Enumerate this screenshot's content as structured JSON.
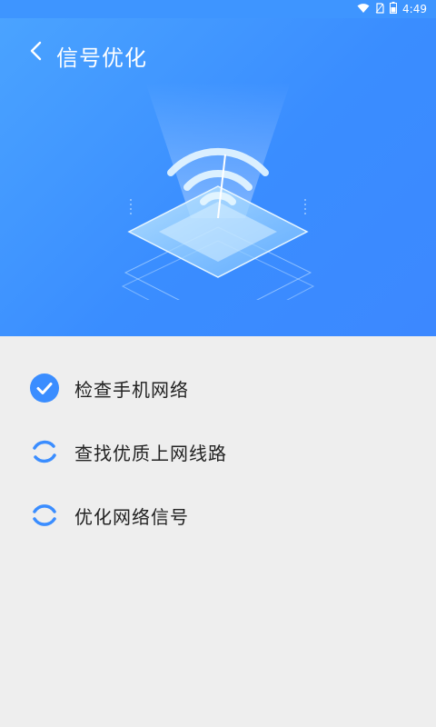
{
  "status_bar": {
    "time": "4:49",
    "icons": [
      "wifi-icon",
      "no-sim-icon",
      "battery-icon"
    ]
  },
  "header": {
    "title": "信号优化",
    "back_icon": "chevron-left-icon"
  },
  "colors": {
    "primary": "#3a8dff",
    "background": "#eeeeee",
    "text": "#222222"
  },
  "steps": [
    {
      "label": "检查手机网络",
      "status": "done",
      "icon": "check-circle-icon"
    },
    {
      "label": "查找优质上网线路",
      "status": "loading",
      "icon": "spinner-icon"
    },
    {
      "label": "优化网络信号",
      "status": "loading",
      "icon": "spinner-icon"
    }
  ]
}
